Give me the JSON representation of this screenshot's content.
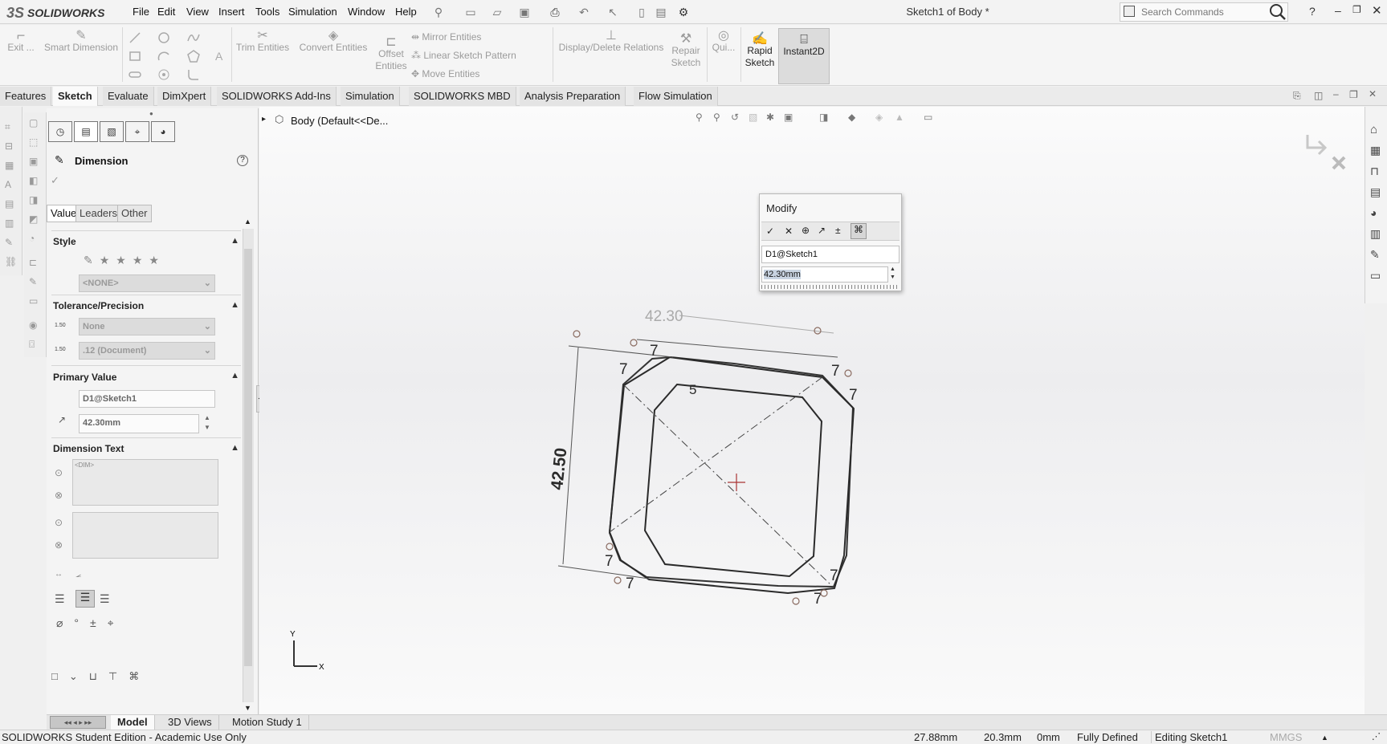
{
  "app": {
    "brand": "SOLIDWORKS",
    "brand_prefix": "3S",
    "document_title": "Sketch1 of Body *"
  },
  "menu": [
    "File",
    "Edit",
    "View",
    "Insert",
    "Tools",
    "Simulation",
    "Window",
    "Help"
  ],
  "search": {
    "placeholder": "Search Commands"
  },
  "commands": {
    "exit": "Exit ...",
    "smart_dimension": "Smart Dimension",
    "trim_entities": "Trim Entities",
    "convert_entities": "Convert Entities",
    "offset_entities": "Offset Entities",
    "mirror_entities": "Mirror Entities",
    "linear_sketch_pattern": "Linear Sketch Pattern",
    "move_entities": "Move Entities",
    "display_delete_relations": "Display/Delete Relations",
    "repair_sketch": "Repair Sketch",
    "quick_snaps": "Qui...",
    "rapid_sketch": "Rapid Sketch",
    "instant2d": "Instant2D"
  },
  "tabs": [
    "Features",
    "Sketch",
    "Evaluate",
    "DimXpert",
    "SOLIDWORKS Add-Ins",
    "Simulation",
    "SOLIDWORKS MBD",
    "Analysis Preparation",
    "Flow Simulation"
  ],
  "active_tab": "Sketch",
  "property_manager": {
    "title": "Dimension",
    "subtabs": [
      "Value",
      "Leaders",
      "Other"
    ],
    "style": {
      "header": "Style",
      "select": "<NONE>"
    },
    "tolerance": {
      "header": "Tolerance/Precision",
      "tolerance_type": "None",
      "precision": ".12 (Document)",
      "tol_icon_text": "1.50",
      "prec_icon_text": "1.50"
    },
    "primary_value": {
      "header": "Primary Value",
      "name": "D1@Sketch1",
      "value": "42.30mm"
    },
    "dimension_text": {
      "header": "Dimension Text",
      "text": "<DIM>"
    }
  },
  "tree": {
    "root": "Body  (Default<<De..."
  },
  "modify": {
    "title": "Modify",
    "name": "D1@Sketch1",
    "value": "42.30mm"
  },
  "sketch": {
    "dim_top": "42.30",
    "dim_left": "42.50",
    "offset_label": "5",
    "chamfer_labels": [
      "7",
      "7",
      "7",
      "7",
      "7",
      "7",
      "7",
      "7"
    ],
    "triad_x": "X",
    "triad_y": "Y"
  },
  "bottom_tabs": [
    "Model",
    "3D Views",
    "Motion Study 1"
  ],
  "active_bottom_tab": "Model",
  "status": {
    "edition": "SOLIDWORKS Student Edition - Academic Use Only",
    "x": "27.88mm",
    "y": "20.3mm",
    "z": "0mm",
    "state": "Fully Defined",
    "editing": "Editing Sketch1",
    "units": "MMGS"
  }
}
